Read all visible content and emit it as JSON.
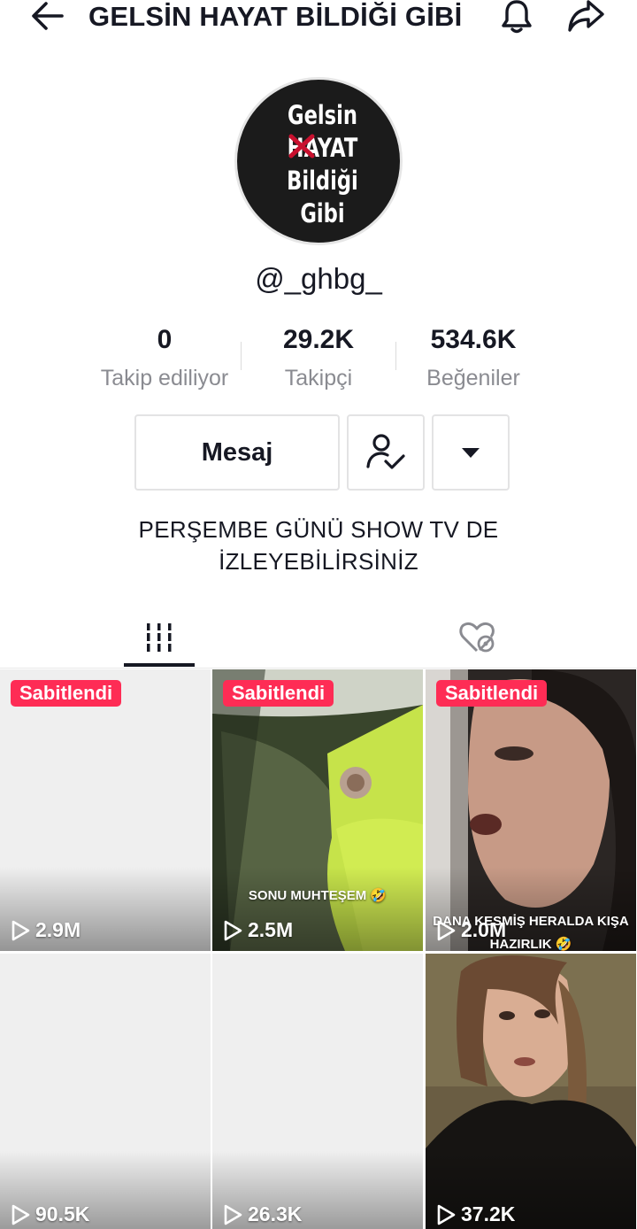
{
  "header": {
    "title": "GELSİN HAYAT BİLDİĞİ GİBİ",
    "back_icon": "back-arrow-icon",
    "bell_icon": "bell-icon",
    "share_icon": "share-icon"
  },
  "profile": {
    "avatar_lines": [
      "Gelsin",
      "HAYAT",
      "Bildiği",
      "Gibi"
    ],
    "username": "@_ghbg_",
    "bio_line1": "PERŞEMBE GÜNÜ SHOW TV DE",
    "bio_line2": "İZLEYEBİLİRSİNİZ"
  },
  "stats": [
    {
      "value": "0",
      "label": "Takip ediliyor"
    },
    {
      "value": "29.2K",
      "label": "Takipçi"
    },
    {
      "value": "534.6K",
      "label": "Beğeniler"
    }
  ],
  "actions": {
    "message_label": "Mesaj",
    "follow_icon": "user-check-icon",
    "more_icon": "caret-down-icon"
  },
  "tabs": [
    {
      "icon": "grid-icon",
      "active": true
    },
    {
      "icon": "private-heart-icon",
      "active": false
    }
  ],
  "videos": [
    {
      "pinned_label": "Sabitlendi",
      "views": "2.9M",
      "caption": ""
    },
    {
      "pinned_label": "Sabitlendi",
      "views": "2.5M",
      "caption": "SONU MUHTEŞEM 🤣"
    },
    {
      "pinned_label": "Sabitlendi",
      "views": "2.0M",
      "caption": "DANA KESMİŞ HERALDA KIŞA HAZIRLIK 🤣"
    },
    {
      "pinned_label": "",
      "views": "90.5K",
      "caption": ""
    },
    {
      "pinned_label": "",
      "views": "26.3K",
      "caption": ""
    },
    {
      "pinned_label": "",
      "views": "37.2K",
      "caption": ""
    }
  ],
  "colors": {
    "accent": "#fe2c55",
    "text": "#161823",
    "muted": "#8a8b91"
  }
}
